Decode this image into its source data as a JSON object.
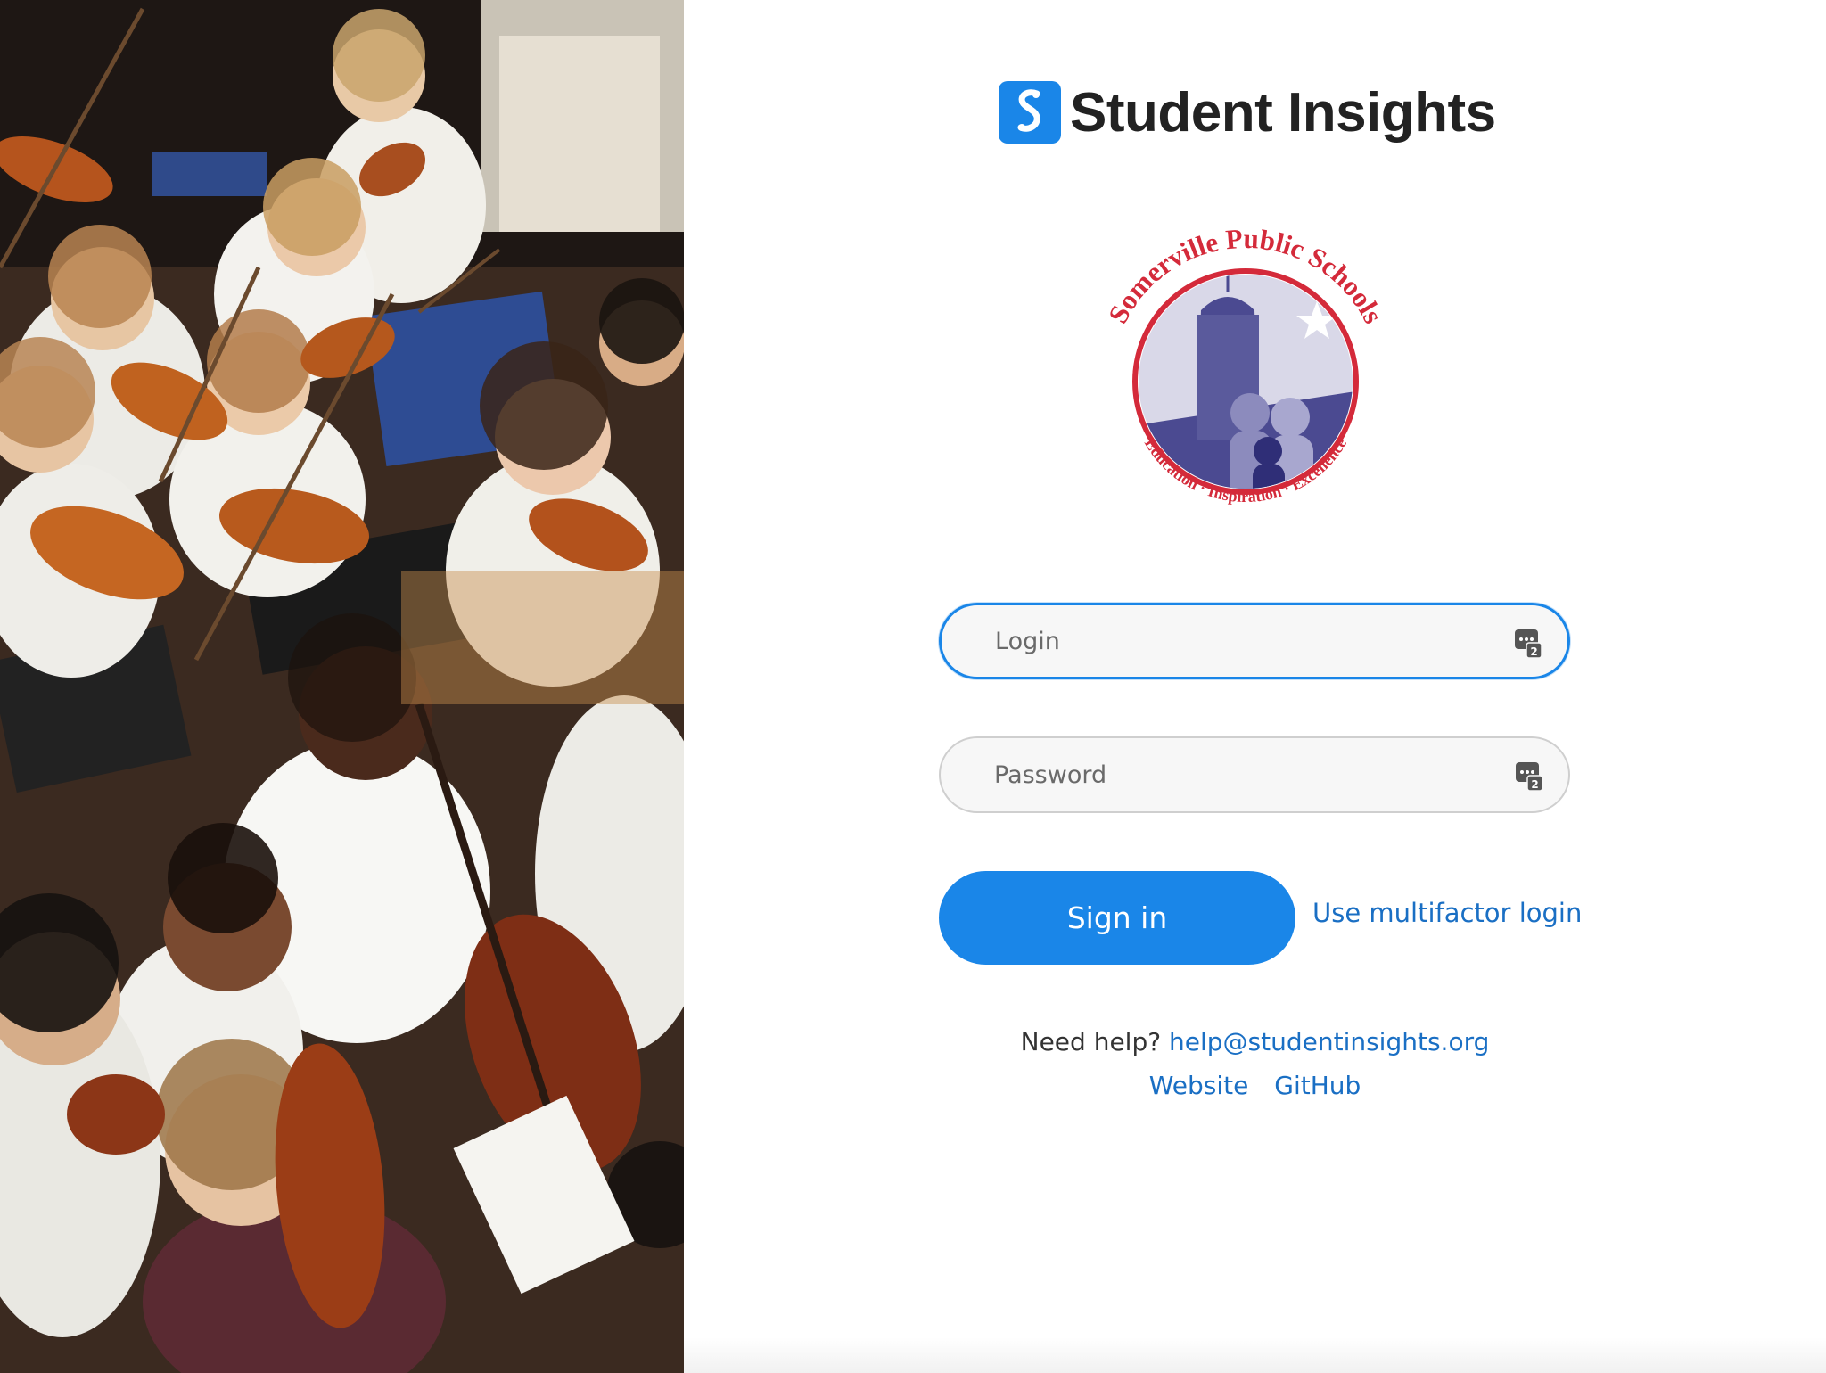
{
  "app": {
    "name": "Student Insights"
  },
  "district": {
    "seal_text_top": "Somerville Public Schools",
    "seal_text_bottom": "Education · Inspiration · Excellence"
  },
  "form": {
    "login_placeholder": "Login",
    "login_value": "",
    "password_placeholder": "Password",
    "password_value": "",
    "sign_in_label": "Sign in",
    "multifactor_link": "Use multifactor login"
  },
  "help": {
    "prefix": "Need help?",
    "email": "help@studentinsights.org"
  },
  "footer_links": {
    "website": "Website",
    "github": "GitHub"
  },
  "colors": {
    "accent": "#1a86e8",
    "link": "#1a6fc4",
    "seal_red": "#d42a3a",
    "seal_purple": "#4b4a91"
  },
  "icons": {
    "brand": "student-insights-logo-icon",
    "password_manager": "password-manager-icon"
  }
}
